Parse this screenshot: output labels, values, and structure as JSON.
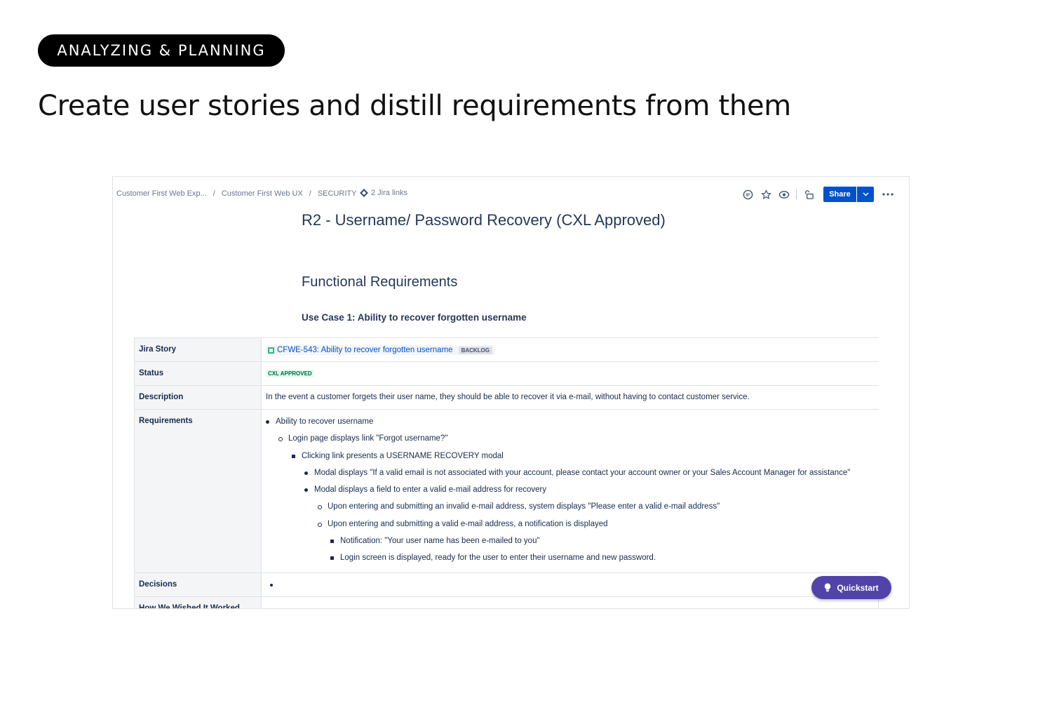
{
  "pill": "ANALYZING & PLANNING",
  "headline": "Create user stories and distill requirements from them",
  "confluence": {
    "breadcrumb": [
      "Customer First Web Exp...",
      "Customer First Web UX",
      "SECURITY"
    ],
    "breadcrumb_sep": "/",
    "jira_links": "2 Jira links",
    "share_label": "Share",
    "page_title": "R2 - Username/ Password Recovery (CXL Approved)",
    "section_title": "Functional Requirements",
    "use_case": "Use Case 1: Ability to recover forgotten username",
    "table": {
      "jira_story_label": "Jira Story",
      "jira_story_link": "CFWE-543: Ability to recover forgotten username",
      "jira_story_status": "BACKLOG",
      "status_label": "Status",
      "status_value": "CXL APPROVED",
      "description_label": "Description",
      "description_value": "In the event a customer forgets their user name, they should be able to recover it via e-mail, without having to contact customer service.",
      "requirements_label": "Requirements",
      "requirements": [
        "Ability to recover username",
        "Login page displays link \"Forgot username?\"",
        "Clicking link presents a USERNAME RECOVERY modal",
        "Modal displays \"If a valid email is not associated with your account, please contact your account owner or your Sales Account Manager for assistance\"",
        "Modal displays a field to enter a valid e-mail address for recovery",
        "Upon entering and submitting an invalid e-mail address, system displays \"Please enter a valid e-mail address\"",
        "Upon entering and submitting a valid e-mail address, a notification is displayed",
        "Notification: \"Your user name has been e-mailed to you\"",
        "Login screen is displayed, ready for the user to enter their username and new password."
      ],
      "decisions_label": "Decisions",
      "how_label": "How We Wished It Worked"
    },
    "quickstart_label": "Quickstart"
  },
  "colors": {
    "share_blue": "#0052cc",
    "quickstart_purple": "#5243aa",
    "approved_green": "#006644"
  }
}
